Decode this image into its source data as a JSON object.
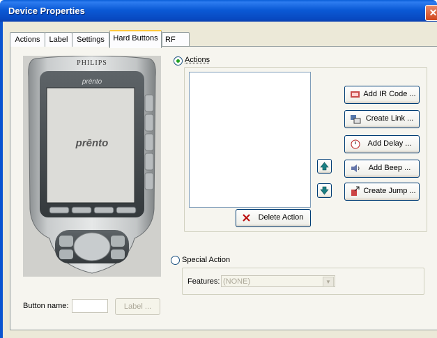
{
  "window": {
    "title": "Device Properties",
    "close_glyph": "✕"
  },
  "tabs": [
    {
      "label": "Actions",
      "active": false
    },
    {
      "label": "Label",
      "active": false
    },
    {
      "label": "Settings",
      "active": false
    },
    {
      "label": "Hard Buttons",
      "active": true
    },
    {
      "label": "RF",
      "active": false
    }
  ],
  "remote": {
    "brand": "PHILIPS",
    "logo_top": "prēnto",
    "logo_screen": "prēnto"
  },
  "actions_radio": {
    "label": "Actions",
    "selected": true
  },
  "buttons": {
    "add_ir": "Add IR Code ...",
    "create_link": "Create Link ...",
    "add_delay": "Add Delay ...",
    "add_beep": "Add Beep ...",
    "create_jump": "Create Jump ...",
    "delete_action": "Delete Action"
  },
  "special_radio": {
    "label": "Special Action",
    "selected": false
  },
  "features": {
    "label": "Features:",
    "value": "(NONE)"
  },
  "button_name": {
    "label": "Button name:",
    "value": "",
    "label_button": "Label ..."
  },
  "colors": {
    "title_bar": "#0b5ad6",
    "panel": "#f6f5ef",
    "dialog": "#ece9d8"
  }
}
